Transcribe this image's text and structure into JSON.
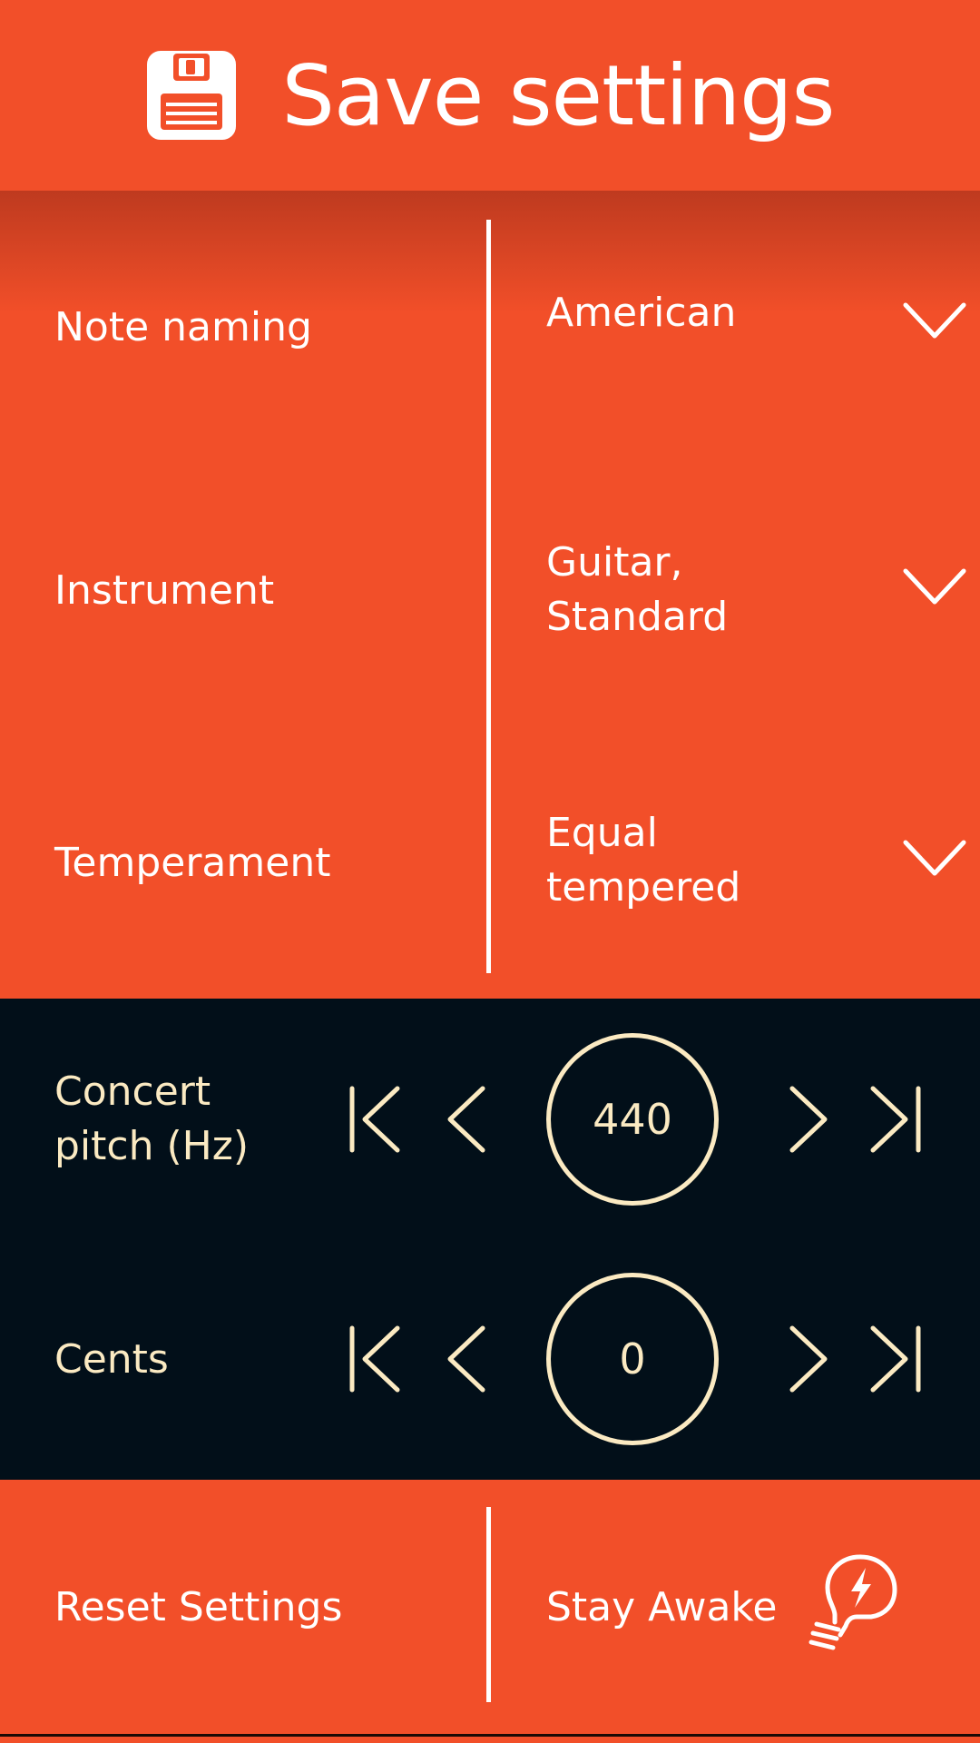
{
  "header": {
    "title": "Save settings",
    "icon": "floppy-disk-icon"
  },
  "settings": [
    {
      "label": "Note naming",
      "value": "American",
      "icon": "chevron-down-icon"
    },
    {
      "label": "Instrument",
      "value": "Guitar,\nStandard",
      "icon": "chevron-down-icon"
    },
    {
      "label": "Temperament",
      "value": "Equal\ntempered",
      "icon": "chevron-down-icon"
    }
  ],
  "pitch": {
    "concert": {
      "label": "Concert\npitch (Hz)",
      "value": "440"
    },
    "cents": {
      "label": "Cents",
      "value": "0"
    }
  },
  "footer": {
    "reset_label": "Reset Settings",
    "awake_label": "Stay Awake",
    "awake_icon": "lightbulb-bolt-icon"
  },
  "colors": {
    "accent": "#F24F29",
    "dark_panel": "#020F19",
    "cream": "#FBEAC2",
    "text": "#FFFFFF"
  }
}
